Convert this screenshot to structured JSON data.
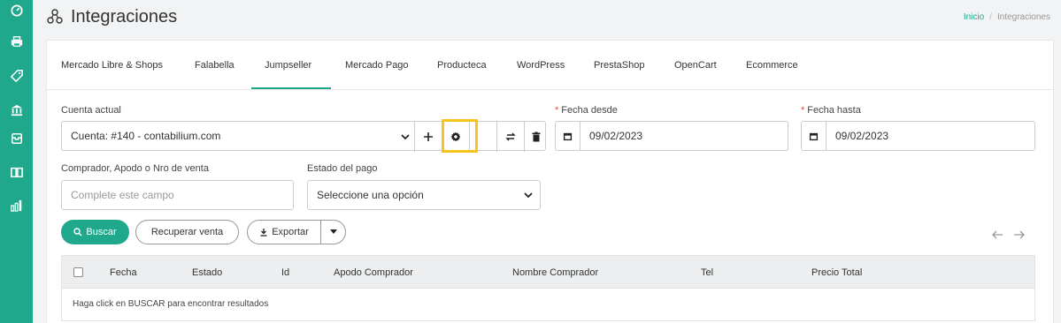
{
  "sidebar": {
    "icons": [
      "dashboard-icon",
      "printer-icon",
      "tag-icon",
      "bank-icon",
      "inbox-icon",
      "book-icon",
      "bar-chart-icon"
    ]
  },
  "header": {
    "title": "Integraciones",
    "breadcrumb": {
      "home": "Inicio",
      "current": "Integraciones"
    }
  },
  "tabs": [
    "Mercado Libre & Shops",
    "Falabella",
    "Jumpseller",
    "Mercado Pago",
    "Producteca",
    "WordPress",
    "PrestaShop",
    "OpenCart",
    "Ecommerce"
  ],
  "active_tab": "Jumpseller",
  "form": {
    "cuenta_label": "Cuenta actual",
    "cuenta_value": "Cuenta: #140 -  contabilium.com",
    "fecha_desde_label": "Fecha desde",
    "fecha_desde_value": "09/02/2023",
    "fecha_hasta_label": "Fecha hasta",
    "fecha_hasta_value": "09/02/2023",
    "required_mark": "*",
    "comprador_label": "Comprador, Apodo o Nro de venta",
    "comprador_placeholder": "Complete este campo",
    "estado_label": "Estado del pago",
    "estado_value": "Seleccione una opción"
  },
  "actions": {
    "buscar": "Buscar",
    "recuperar": "Recuperar venta",
    "exportar": "Exportar"
  },
  "table": {
    "columns": [
      "Fecha",
      "Estado",
      "Id",
      "Apodo Comprador",
      "Nombre Comprador",
      "Tel",
      "Precio Total"
    ],
    "empty_message": "Haga click en BUSCAR para encontrar resultados"
  },
  "colors": {
    "accent": "#1fa88b",
    "highlight": "#f7c41b"
  }
}
